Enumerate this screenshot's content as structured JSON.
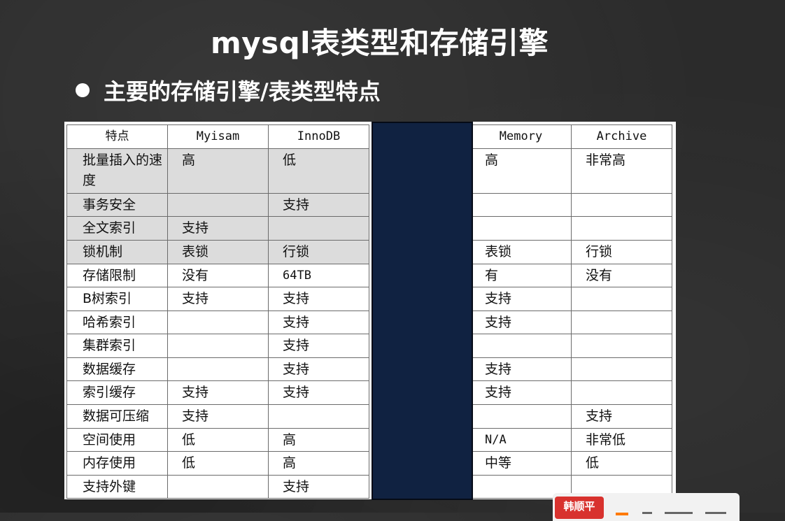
{
  "slide": {
    "title": "mysql表类型和存储引擎",
    "bullet": "主要的存储引擎/表类型特点"
  },
  "table": {
    "headers": [
      "特点",
      "Myisam",
      "InnoDB",
      "Memory",
      "Archive"
    ],
    "rows": [
      {
        "feature": "批量插入的速度",
        "myisam": "高",
        "innodb": "低",
        "memory": "高",
        "archive": "非常高"
      },
      {
        "feature": "事务安全",
        "myisam": "",
        "innodb": "支持",
        "memory": "",
        "archive": ""
      },
      {
        "feature": "全文索引",
        "myisam": "支持",
        "innodb": "",
        "memory": "",
        "archive": ""
      },
      {
        "feature": "锁机制",
        "myisam": "表锁",
        "innodb": "行锁",
        "memory": "表锁",
        "archive": "行锁"
      },
      {
        "feature": "存储限制",
        "myisam": "没有",
        "innodb": "64TB",
        "memory": "有",
        "archive": "没有"
      },
      {
        "feature": "B树索引",
        "myisam": "支持",
        "innodb": "支持",
        "memory": "支持",
        "archive": ""
      },
      {
        "feature": "哈希索引",
        "myisam": "",
        "innodb": "支持",
        "memory": "支持",
        "archive": ""
      },
      {
        "feature": "集群索引",
        "myisam": "",
        "innodb": "支持",
        "memory": "",
        "archive": ""
      },
      {
        "feature": "数据缓存",
        "myisam": "",
        "innodb": "支持",
        "memory": "支持",
        "archive": ""
      },
      {
        "feature": "索引缓存",
        "myisam": "支持",
        "innodb": "支持",
        "memory": "支持",
        "archive": ""
      },
      {
        "feature": "数据可压缩",
        "myisam": "支持",
        "innodb": "",
        "memory": "",
        "archive": "支持"
      },
      {
        "feature": "空间使用",
        "myisam": "低",
        "innodb": "高",
        "memory": "N/A",
        "archive": "非常低"
      },
      {
        "feature": "内存使用",
        "myisam": "低",
        "innodb": "高",
        "memory": "中等",
        "archive": "低"
      },
      {
        "feature": "支持外键",
        "myisam": "",
        "innodb": "支持",
        "memory": "",
        "archive": ""
      }
    ]
  },
  "overlay": {
    "badge_label": "韩顺平",
    "redaction_color": "#102241",
    "badge_color": "#d8322e",
    "shade_color": "#dcdcdc"
  }
}
